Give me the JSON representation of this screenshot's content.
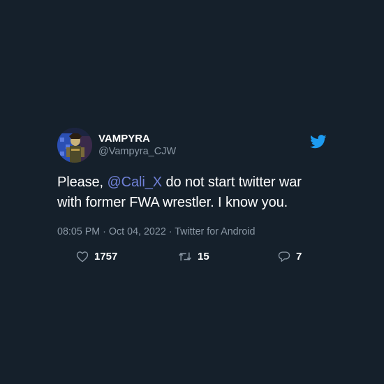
{
  "tweet": {
    "display_name": "VAMPYRA",
    "handle": "@Vampyra_CJW",
    "text_before": "Please, ",
    "mention": "@Cali_X",
    "text_after": " do not start twitter war with former FWA wrestler. I know you.",
    "timestamp": "08:05 PM · Oct 04, 2022 · Twitter for Android",
    "likes": "1757",
    "retweets": "15",
    "replies": "7"
  },
  "icons": {
    "logo": "twitter-bird-icon",
    "like": "heart-icon",
    "retweet": "retweet-icon",
    "reply": "reply-bubble-icon"
  },
  "colors": {
    "background": "#15202b",
    "mention": "#6f80d6",
    "brand": "#1d9bf0",
    "muted": "#8b98a5"
  }
}
